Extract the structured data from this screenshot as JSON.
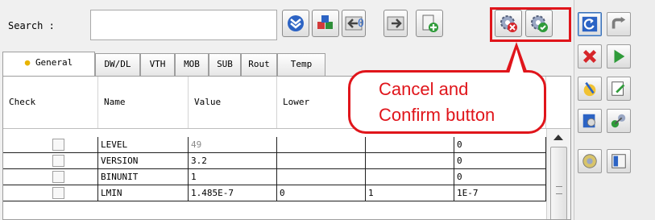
{
  "search": {
    "label": "Search :",
    "value": "",
    "placeholder": ""
  },
  "toolbar": {
    "counter": "0",
    "buttons": [
      {
        "name": "scroll-down-icon"
      },
      {
        "name": "load-cubes-icon"
      },
      {
        "name": "previous-arrow-icon"
      },
      {
        "name": "next-arrow-icon"
      },
      {
        "name": "add-document-icon"
      },
      {
        "name": "cancel-gear-icon"
      },
      {
        "name": "confirm-gear-icon"
      }
    ]
  },
  "tabs": [
    {
      "label": "General",
      "icon": "bulb-icon",
      "active": true
    },
    {
      "label": "DW/DL"
    },
    {
      "label": "VTH"
    },
    {
      "label": "MOB"
    },
    {
      "label": "SUB"
    },
    {
      "label": "Rout"
    },
    {
      "label": "Temp"
    }
  ],
  "table": {
    "columns": [
      "Check",
      "Name",
      "Value",
      "Lower",
      "",
      ""
    ],
    "rows": [
      {
        "checked": false,
        "name": "LEVEL",
        "value": "49",
        "lower": "",
        "upper": "",
        "default": "0",
        "value_greyed": true
      },
      {
        "checked": false,
        "name": "VERSION",
        "value": "3.2",
        "lower": "",
        "upper": "",
        "default": "0"
      },
      {
        "checked": false,
        "name": "BINUNIT",
        "value": "1",
        "lower": "",
        "upper": "",
        "default": "0"
      },
      {
        "checked": false,
        "name": "LMIN",
        "value": "1.485E-7",
        "lower": "0",
        "upper": "1",
        "default": "1E-7"
      }
    ]
  },
  "annotation": {
    "line1": "Cancel and",
    "line2": "Confirm button",
    "color": "#e0151b"
  },
  "side_toolbar": [
    {
      "name": "refresh-icon"
    },
    {
      "name": "redo-icon"
    },
    {
      "name": "delete-icon"
    },
    {
      "name": "play-icon"
    },
    {
      "name": "clean-brush-icon"
    },
    {
      "name": "edit-note-icon"
    },
    {
      "name": "settings-icon"
    },
    {
      "name": "network-icon"
    },
    {
      "name": "tools-icon"
    },
    {
      "name": "report-icon"
    }
  ]
}
